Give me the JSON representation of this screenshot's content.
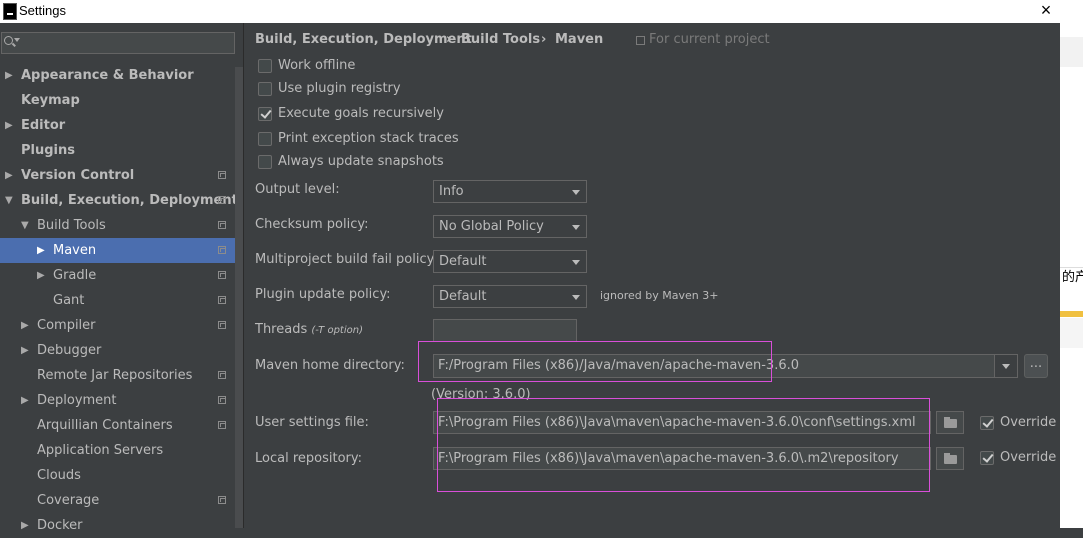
{
  "window": {
    "title": "Settings",
    "close_glyph": "×"
  },
  "background_window": {
    "partial_text": "的产"
  },
  "sidebar": {
    "search_placeholder": "",
    "items": [
      {
        "label": "Appearance & Behavior",
        "arrow": "▶",
        "bold": true
      },
      {
        "label": "Keymap",
        "arrow": "",
        "bold": true
      },
      {
        "label": "Editor",
        "arrow": "▶",
        "bold": true
      },
      {
        "label": "Plugins",
        "arrow": "",
        "bold": true
      },
      {
        "label": "Version Control",
        "arrow": "▶",
        "bold": true
      },
      {
        "label": "Build, Execution, Deployment",
        "arrow": "▼",
        "bold": true
      },
      {
        "label": "Build Tools",
        "arrow": "▼",
        "bold": false
      },
      {
        "label": "Maven",
        "arrow": "▶",
        "bold": false,
        "selected": true
      },
      {
        "label": "Gradle",
        "arrow": "▶",
        "bold": false
      },
      {
        "label": "Gant",
        "arrow": "",
        "bold": false
      },
      {
        "label": "Compiler",
        "arrow": "▶",
        "bold": false
      },
      {
        "label": "Debugger",
        "arrow": "▶",
        "bold": false
      },
      {
        "label": "Remote Jar Repositories",
        "arrow": "",
        "bold": false
      },
      {
        "label": "Deployment",
        "arrow": "▶",
        "bold": false
      },
      {
        "label": "Arquillian Containers",
        "arrow": "",
        "bold": false
      },
      {
        "label": "Application Servers",
        "arrow": "",
        "bold": false
      },
      {
        "label": "Clouds",
        "arrow": "",
        "bold": false
      },
      {
        "label": "Coverage",
        "arrow": "",
        "bold": false
      },
      {
        "label": "Docker",
        "arrow": "▶",
        "bold": false
      }
    ]
  },
  "breadcrumb": {
    "part1": "Build, Execution, Deployment",
    "sep1": "›",
    "part2": "Build Tools",
    "sep2": "›",
    "part3": "Maven",
    "scope": "For current project"
  },
  "checkboxes": [
    {
      "label": "Work offline",
      "checked": false
    },
    {
      "label": "Use plugin registry",
      "checked": false
    },
    {
      "label": "Execute goals recursively",
      "checked": true
    },
    {
      "label": "Print exception stack traces",
      "checked": false
    },
    {
      "label": "Always update snapshots",
      "checked": false
    }
  ],
  "form": {
    "output_level_label": "Output level:",
    "output_level_value": "Info",
    "checksum_label": "Checksum policy:",
    "checksum_value": "No Global Policy",
    "multiproject_label": "Multiproject build fail policy:",
    "multiproject_value": "Default",
    "plugin_update_label": "Plugin update policy:",
    "plugin_update_value": "Default",
    "plugin_update_note": "ignored by Maven 3+",
    "threads_label": "Threads",
    "threads_hint": "(-T option)",
    "threads_value": "",
    "maven_home_label": "Maven home directory:",
    "maven_home_value": "F:/Program Files (x86)/Java/maven/apache-maven-3.6.0",
    "browse_label": "...",
    "version_note": "(Version: 3.6.0)",
    "user_settings_label": "User settings file:",
    "user_settings_value": "F:\\Program Files (x86)\\Java\\maven\\apache-maven-3.6.0\\conf\\settings.xml",
    "user_settings_override": "Override",
    "local_repo_label": "Local repository:",
    "local_repo_value": "F:\\Program Files (x86)\\Java\\maven\\apache-maven-3.6.0\\.m2\\repository",
    "local_repo_override": "Override"
  },
  "colors": {
    "highlight": "#d94fd9",
    "selection": "#4b6eaf",
    "panel": "#3c3f41"
  }
}
